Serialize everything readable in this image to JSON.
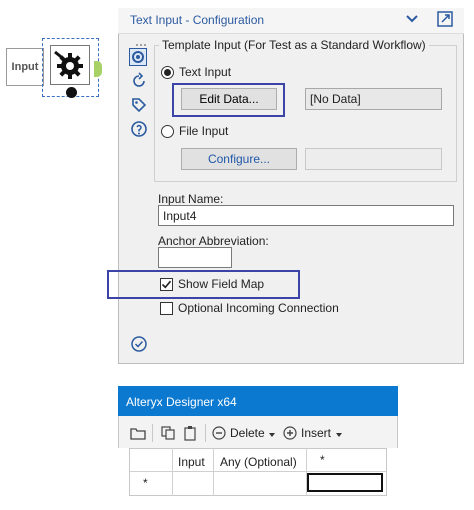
{
  "workflow": {
    "input_tool_label": "Input"
  },
  "config": {
    "title": "Text Input - Configuration",
    "template_group_label": "Template Input (For Test as a Standard Workflow)",
    "text_input_label": "Text Input",
    "edit_data_label": "Edit Data...",
    "data_status": "[No Data]",
    "file_input_label": "File Input",
    "configure_label": "Configure...",
    "input_name_label": "Input Name:",
    "input_name_value": "Input4",
    "anchor_label": "Anchor Abbreviation:",
    "anchor_value": "",
    "show_field_map_label": "Show Field Map",
    "show_field_map_checked": true,
    "optional_incoming_label": "Optional Incoming Connection",
    "optional_incoming_checked": false,
    "selected_source": "Text Input"
  },
  "designer": {
    "title": "Alteryx Designer x64",
    "toolbar": {
      "delete_label": "Delete",
      "insert_label": "Insert"
    },
    "grid": {
      "headers": [
        "",
        "Input",
        "Any (Optional)",
        "*"
      ],
      "rows": [
        [
          "*",
          "",
          "",
          ""
        ]
      ]
    }
  },
  "colors": {
    "highlight": "#3b44a6",
    "title_blue": "#2c5aa0",
    "designer_titlebar": "#0b79d0",
    "output_anchor": "#a8d268"
  },
  "icons": {
    "tool": "gear-arrow-icon",
    "sidebar": [
      "gear-icon",
      "refresh-icon",
      "tag-icon",
      "help-icon"
    ],
    "footer": "check-circle-icon"
  }
}
